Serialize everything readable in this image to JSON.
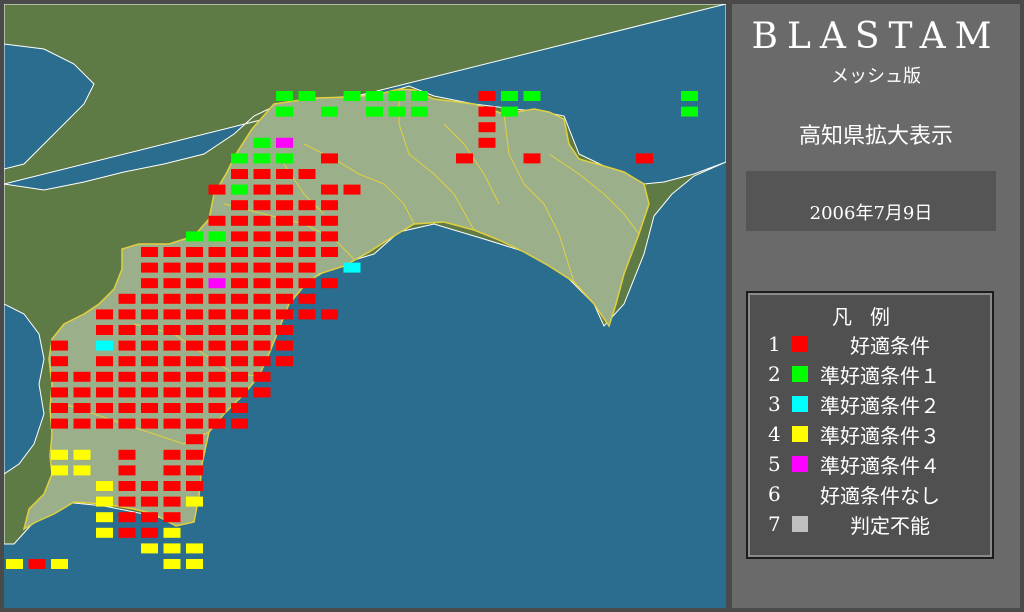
{
  "header": {
    "title": "BLASTAM",
    "subtitle": "メッシュ版",
    "region": "高知県拡大表示",
    "date": "2006年7月9日"
  },
  "legend": {
    "title": "凡例",
    "items": [
      {
        "num": "1",
        "label": "好適条件",
        "color": "#ff0000"
      },
      {
        "num": "2",
        "label": "準好適条件１",
        "color": "#00ff00"
      },
      {
        "num": "3",
        "label": "準好適条件２",
        "color": "#00ffff"
      },
      {
        "num": "4",
        "label": "準好適条件３",
        "color": "#ffff00"
      },
      {
        "num": "5",
        "label": "準好適条件４",
        "color": "#ff00ff"
      },
      {
        "num": "6",
        "label": "好適条件なし",
        "color": null
      },
      {
        "num": "7",
        "label": "判定不能",
        "color": "#c0c0c0"
      }
    ]
  },
  "colors": {
    "sea": "#2a6d8e",
    "land_outside": "#5e7a45",
    "kochi": "#9bb08a",
    "boundary": "#e0d040",
    "panel": "#6a6a6a"
  },
  "map": {
    "grid": {
      "col0": 51,
      "col_step": 22.5,
      "row0": 91,
      "row_step": 15.6
    },
    "cells": [
      [
        0,
        10,
        2
      ],
      [
        0,
        11,
        2
      ],
      [
        0,
        13,
        2
      ],
      [
        0,
        14,
        2
      ],
      [
        0,
        15,
        2
      ],
      [
        0,
        16,
        2
      ],
      [
        0,
        19,
        1
      ],
      [
        0,
        20,
        2
      ],
      [
        0,
        21,
        2
      ],
      [
        0,
        28,
        2
      ],
      [
        1,
        10,
        2
      ],
      [
        1,
        12,
        2
      ],
      [
        1,
        14,
        2
      ],
      [
        1,
        15,
        2
      ],
      [
        1,
        16,
        2
      ],
      [
        1,
        19,
        1
      ],
      [
        1,
        20,
        2
      ],
      [
        1,
        28,
        2
      ],
      [
        2,
        19,
        1
      ],
      [
        3,
        9,
        2
      ],
      [
        3,
        10,
        5
      ],
      [
        3,
        19,
        1
      ],
      [
        4,
        8,
        2
      ],
      [
        4,
        9,
        2
      ],
      [
        4,
        10,
        2
      ],
      [
        4,
        12,
        1
      ],
      [
        4,
        18,
        1
      ],
      [
        4,
        21,
        1
      ],
      [
        4,
        26,
        1
      ],
      [
        5,
        8,
        1
      ],
      [
        5,
        9,
        1
      ],
      [
        5,
        10,
        1
      ],
      [
        5,
        11,
        1
      ],
      [
        6,
        7,
        1
      ],
      [
        6,
        8,
        2
      ],
      [
        6,
        9,
        1
      ],
      [
        6,
        10,
        1
      ],
      [
        6,
        12,
        1
      ],
      [
        6,
        13,
        1
      ],
      [
        7,
        8,
        1
      ],
      [
        7,
        9,
        1
      ],
      [
        7,
        10,
        1
      ],
      [
        7,
        11,
        1
      ],
      [
        7,
        12,
        1
      ],
      [
        8,
        7,
        1
      ],
      [
        8,
        8,
        1
      ],
      [
        8,
        9,
        1
      ],
      [
        8,
        10,
        1
      ],
      [
        8,
        11,
        1
      ],
      [
        8,
        12,
        1
      ],
      [
        9,
        6,
        2
      ],
      [
        9,
        7,
        2
      ],
      [
        9,
        8,
        1
      ],
      [
        9,
        9,
        1
      ],
      [
        9,
        10,
        1
      ],
      [
        9,
        11,
        1
      ],
      [
        9,
        12,
        1
      ],
      [
        10,
        4,
        1
      ],
      [
        10,
        5,
        1
      ],
      [
        10,
        6,
        1
      ],
      [
        10,
        7,
        1
      ],
      [
        10,
        8,
        1
      ],
      [
        10,
        9,
        1
      ],
      [
        10,
        10,
        1
      ],
      [
        10,
        11,
        1
      ],
      [
        10,
        12,
        1
      ],
      [
        11,
        4,
        1
      ],
      [
        11,
        5,
        1
      ],
      [
        11,
        6,
        1
      ],
      [
        11,
        7,
        1
      ],
      [
        11,
        8,
        1
      ],
      [
        11,
        9,
        1
      ],
      [
        11,
        10,
        1
      ],
      [
        11,
        11,
        1
      ],
      [
        11,
        13,
        3
      ],
      [
        12,
        4,
        1
      ],
      [
        12,
        5,
        1
      ],
      [
        12,
        6,
        1
      ],
      [
        12,
        7,
        5
      ],
      [
        12,
        8,
        1
      ],
      [
        12,
        9,
        1
      ],
      [
        12,
        10,
        1
      ],
      [
        12,
        11,
        1
      ],
      [
        12,
        12,
        1
      ],
      [
        13,
        3,
        1
      ],
      [
        13,
        4,
        1
      ],
      [
        13,
        5,
        1
      ],
      [
        13,
        6,
        1
      ],
      [
        13,
        7,
        1
      ],
      [
        13,
        8,
        1
      ],
      [
        13,
        9,
        1
      ],
      [
        13,
        10,
        1
      ],
      [
        13,
        11,
        1
      ],
      [
        14,
        2,
        1
      ],
      [
        14,
        3,
        1
      ],
      [
        14,
        4,
        1
      ],
      [
        14,
        5,
        1
      ],
      [
        14,
        6,
        1
      ],
      [
        14,
        7,
        1
      ],
      [
        14,
        8,
        1
      ],
      [
        14,
        9,
        1
      ],
      [
        14,
        10,
        1
      ],
      [
        14,
        11,
        1
      ],
      [
        14,
        12,
        1
      ],
      [
        15,
        2,
        1
      ],
      [
        15,
        3,
        1
      ],
      [
        15,
        4,
        1
      ],
      [
        15,
        5,
        1
      ],
      [
        15,
        6,
        1
      ],
      [
        15,
        7,
        1
      ],
      [
        15,
        8,
        1
      ],
      [
        15,
        9,
        1
      ],
      [
        15,
        10,
        1
      ],
      [
        16,
        0,
        1
      ],
      [
        16,
        2,
        3
      ],
      [
        16,
        3,
        1
      ],
      [
        16,
        4,
        1
      ],
      [
        16,
        5,
        1
      ],
      [
        16,
        6,
        1
      ],
      [
        16,
        7,
        1
      ],
      [
        16,
        8,
        1
      ],
      [
        16,
        9,
        1
      ],
      [
        16,
        10,
        1
      ],
      [
        17,
        0,
        1
      ],
      [
        17,
        2,
        1
      ],
      [
        17,
        3,
        1
      ],
      [
        17,
        4,
        1
      ],
      [
        17,
        5,
        1
      ],
      [
        17,
        6,
        1
      ],
      [
        17,
        7,
        1
      ],
      [
        17,
        8,
        1
      ],
      [
        17,
        9,
        1
      ],
      [
        17,
        10,
        1
      ],
      [
        18,
        0,
        1
      ],
      [
        18,
        1,
        1
      ],
      [
        18,
        2,
        1
      ],
      [
        18,
        3,
        1
      ],
      [
        18,
        4,
        1
      ],
      [
        18,
        5,
        1
      ],
      [
        18,
        6,
        1
      ],
      [
        18,
        7,
        1
      ],
      [
        18,
        8,
        1
      ],
      [
        18,
        9,
        1
      ],
      [
        19,
        0,
        1
      ],
      [
        19,
        1,
        1
      ],
      [
        19,
        2,
        1
      ],
      [
        19,
        3,
        1
      ],
      [
        19,
        4,
        1
      ],
      [
        19,
        5,
        1
      ],
      [
        19,
        6,
        1
      ],
      [
        19,
        7,
        1
      ],
      [
        19,
        8,
        1
      ],
      [
        19,
        9,
        1
      ],
      [
        20,
        0,
        1
      ],
      [
        20,
        1,
        1
      ],
      [
        20,
        2,
        1
      ],
      [
        20,
        3,
        1
      ],
      [
        20,
        4,
        1
      ],
      [
        20,
        5,
        1
      ],
      [
        20,
        6,
        1
      ],
      [
        20,
        7,
        1
      ],
      [
        20,
        8,
        1
      ],
      [
        21,
        0,
        1
      ],
      [
        21,
        1,
        1
      ],
      [
        21,
        2,
        1
      ],
      [
        21,
        3,
        1
      ],
      [
        21,
        4,
        1
      ],
      [
        21,
        5,
        1
      ],
      [
        21,
        6,
        1
      ],
      [
        21,
        7,
        1
      ],
      [
        21,
        8,
        1
      ],
      [
        22,
        6,
        1
      ],
      [
        23,
        0,
        4
      ],
      [
        23,
        1,
        4
      ],
      [
        23,
        3,
        1
      ],
      [
        23,
        5,
        1
      ],
      [
        23,
        6,
        1
      ],
      [
        24,
        0,
        4
      ],
      [
        24,
        1,
        4
      ],
      [
        24,
        3,
        1
      ],
      [
        24,
        5,
        1
      ],
      [
        24,
        6,
        1
      ],
      [
        25,
        2,
        4
      ],
      [
        25,
        3,
        1
      ],
      [
        25,
        4,
        1
      ],
      [
        25,
        5,
        1
      ],
      [
        25,
        6,
        1
      ],
      [
        26,
        2,
        4
      ],
      [
        26,
        3,
        1
      ],
      [
        26,
        4,
        1
      ],
      [
        26,
        5,
        1
      ],
      [
        26,
        6,
        4
      ],
      [
        27,
        2,
        4
      ],
      [
        27,
        3,
        1
      ],
      [
        27,
        4,
        1
      ],
      [
        27,
        5,
        1
      ],
      [
        28,
        2,
        4
      ],
      [
        28,
        3,
        1
      ],
      [
        28,
        4,
        1
      ],
      [
        28,
        5,
        4
      ],
      [
        29,
        4,
        4
      ],
      [
        29,
        5,
        4
      ],
      [
        29,
        6,
        4
      ],
      [
        30,
        -2,
        4
      ],
      [
        30,
        -1,
        1
      ],
      [
        30,
        0,
        4
      ],
      [
        30,
        5,
        4
      ],
      [
        30,
        6,
        4
      ]
    ]
  }
}
